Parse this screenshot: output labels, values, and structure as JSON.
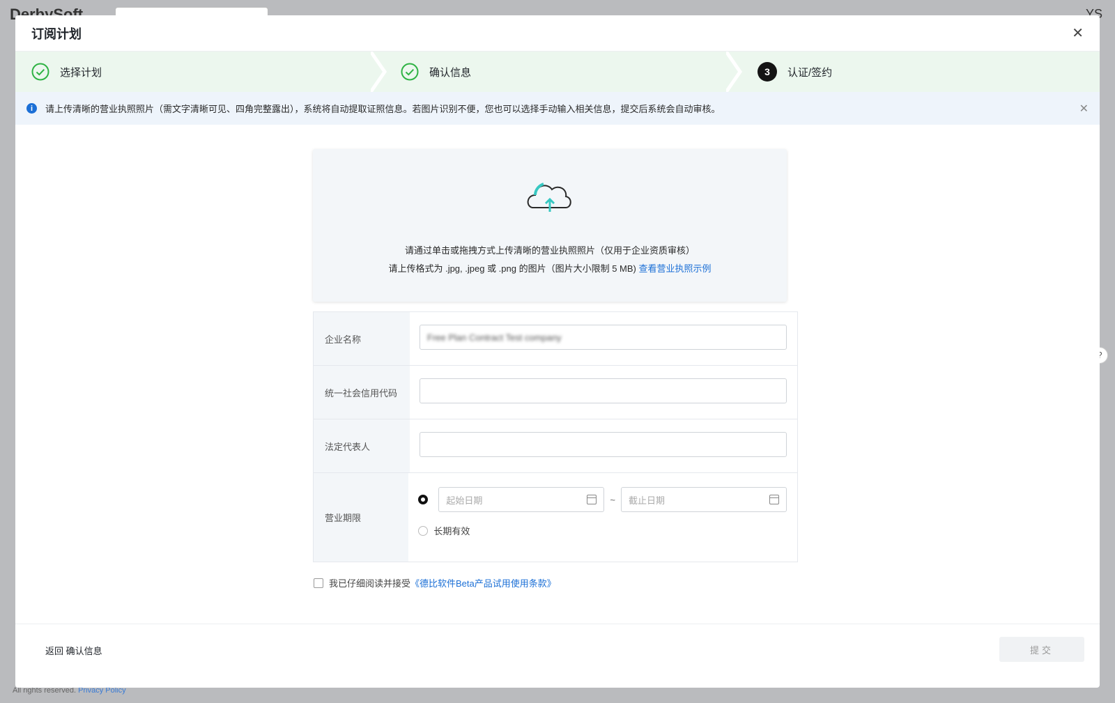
{
  "background": {
    "logo": "DerbySoft",
    "avatar": "YS",
    "footer_text": "All rights reserved.",
    "footer_link": "Privacy Policy"
  },
  "modal": {
    "title": "订阅计划"
  },
  "steps": [
    {
      "label": "选择计划",
      "status": "done"
    },
    {
      "label": "确认信息",
      "status": "done"
    },
    {
      "number": "3",
      "label": "认证/签约",
      "status": "current"
    }
  ],
  "alert": {
    "text": "请上传清晰的营业执照照片（需文字清晰可见、四角完整露出），系统将自动提取证照信息。若图片识别不便，您也可以选择手动输入相关信息，提交后系统会自动审核。"
  },
  "upload": {
    "line1": "请通过单击或拖拽方式上传清晰的营业执照照片（仅用于企业资质审核）",
    "line2": "请上传格式为 .jpg, .jpeg 或 .png 的图片（图片大小限制 5 MB)",
    "link": "查看营业执照示例"
  },
  "form": {
    "company_label": "企业名称",
    "company_value": "Free Plan Contract Test company",
    "credit_label": "统一社会信用代码",
    "credit_value": "",
    "rep_label": "法定代表人",
    "rep_value": "",
    "period_label": "营业期限",
    "start_placeholder": "起始日期",
    "end_placeholder": "截止日期",
    "separator": "~",
    "long_term": "长期有效"
  },
  "agreement": {
    "text": "我已仔细阅读并接受",
    "link": "《德比软件Beta产品试用使用条款》"
  },
  "footer": {
    "back": "返回 确认信息",
    "submit": "提交"
  },
  "colors": {
    "accent": "#1b6fd6",
    "step_bg": "#ecf7ee",
    "done_green": "#2fb344"
  }
}
